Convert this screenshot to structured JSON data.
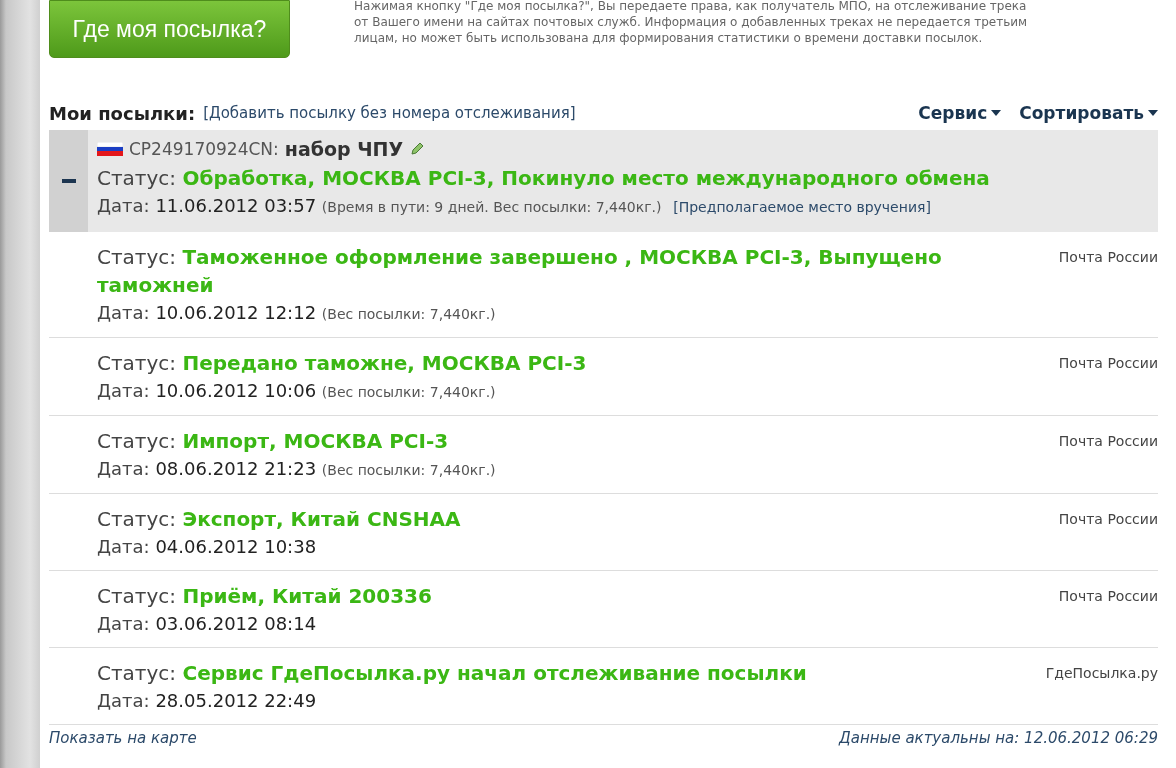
{
  "track_button": {
    "label": "Где моя посылка?"
  },
  "notice": [
    "Нажимая кнопку \"Где моя посылка?\", Вы передаете права, как получатель МПО, на отслеживание трека",
    "от Вашего имени на сайтах почтовых служб. Информация о добавленных треках не передается третьим",
    "лицам, но может быть использована для формирования статистики о времени доставки посылок."
  ],
  "parcels_header": {
    "title": "Мои посылки:",
    "add_link": "[Добавить посылку без номера отслеживания]",
    "menus": [
      {
        "label": "Сервис"
      },
      {
        "label": "Сортировать"
      }
    ]
  },
  "parcel": {
    "track": "CP249170924CN:",
    "name": "набор ЧПУ",
    "expanded": true,
    "events": [
      {
        "status_label": "Статус:",
        "status": "Обработка, МОСКВА PCI-3, Покинуло место международного обмена",
        "date_label": "Дата:",
        "date": "11.06.2012 03:57",
        "note": "(Время в пути: 9 дней. Вес посылки: 7,440кг.)",
        "link": "[Предполагаемое место вручения]"
      },
      {
        "status_label": "Статус:",
        "status": "Таможенное оформление завершено , МОСКВА PCI-3, Выпущено таможней",
        "date_label": "Дата:",
        "date": "10.06.2012 12:12",
        "note": "(Вес посылки: 7,440кг.)",
        "carrier": "Почта России"
      },
      {
        "status_label": "Статус:",
        "status": "Передано таможне, МОСКВА PCI-3",
        "date_label": "Дата:",
        "date": "10.06.2012 10:06",
        "note": "(Вес посылки: 7,440кг.)",
        "carrier": "Почта России"
      },
      {
        "status_label": "Статус:",
        "status": "Импорт, МОСКВА PCI-3",
        "date_label": "Дата:",
        "date": "08.06.2012 21:23",
        "note": "(Вес посылки: 7,440кг.)",
        "carrier": "Почта России"
      },
      {
        "status_label": "Статус:",
        "status": "Экспорт, Китай CNSHAA",
        "date_label": "Дата:",
        "date": "04.06.2012 10:38",
        "carrier": "Почта России"
      },
      {
        "status_label": "Статус:",
        "status": "Приём, Китай 200336",
        "date_label": "Дата:",
        "date": "03.06.2012 08:14",
        "carrier": "Почта России"
      },
      {
        "status_label": "Статус:",
        "status": "Сервис ГдеПосылка.ру начал отслеживание посылки",
        "date_label": "Дата:",
        "date": "28.05.2012 22:49",
        "carrier": "ГдеПосылка.ру"
      }
    ]
  },
  "footer": {
    "map_link": "Показать на карте",
    "updated": "Данные актуальны на: 12.06.2012 06:29"
  }
}
